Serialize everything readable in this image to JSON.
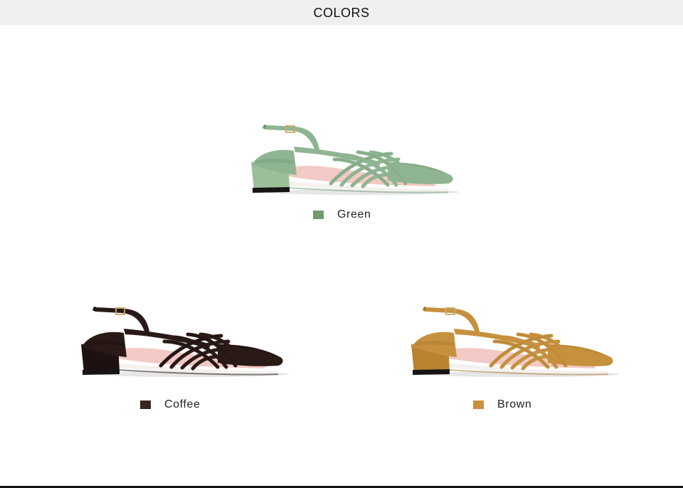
{
  "header": {
    "title": "COLORS"
  },
  "variants": [
    {
      "name": "Green",
      "swatch": "#6f9a72",
      "color": "#8fb491",
      "dark": "#6f9a72",
      "heel": "#9cbf9a"
    },
    {
      "name": "Coffee",
      "swatch": "#3a2420",
      "color": "#2a1a17",
      "dark": "#140c0a",
      "heel": "#1e1210"
    },
    {
      "name": "Brown",
      "swatch": "#c8903f",
      "color": "#c6913f",
      "dark": "#a8762c",
      "heel": "#b98432"
    }
  ],
  "icons": {
    "shoe": "slingback-shoe-icon"
  }
}
